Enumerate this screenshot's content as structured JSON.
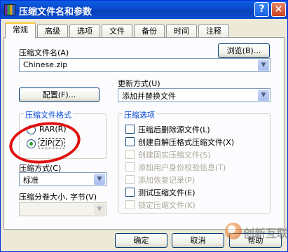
{
  "window": {
    "title": "压缩文件名和参数"
  },
  "titlebar": {
    "help_label": "?",
    "close_label": "×"
  },
  "tabs": [
    "常规",
    "高级",
    "选项",
    "文件",
    "备份",
    "时间",
    "注释"
  ],
  "general": {
    "archive_name_label": "压缩文件名(A)",
    "browse_label": "浏览(B)...",
    "archive_name_value": "Chinese.zip",
    "update_mode_label": "更新方式(U)",
    "profiles_label": "配置(F)...",
    "update_mode_value": "添加并替换文件",
    "format_group_title": "压缩文件格式",
    "format_rar_label": "RAR(R)",
    "format_zip_label": "ZIP(Z)",
    "method_label": "压缩方式(C)",
    "method_value": "标准",
    "split_label": "压缩分卷大小, 字节(V)",
    "split_value": "",
    "options_group_title": "压缩选项",
    "options": [
      {
        "label": "压缩后删除源文件(L)",
        "enabled": true,
        "checked": false
      },
      {
        "label": "创建自解压格式压缩文件(X)",
        "enabled": true,
        "checked": false
      },
      {
        "label": "创建固实压缩文件(S)",
        "enabled": false,
        "checked": false
      },
      {
        "label": "添加用户身份校验信息(T)",
        "enabled": false,
        "checked": false
      },
      {
        "label": "添加恢复记录(P)",
        "enabled": false,
        "checked": false
      },
      {
        "label": "测试压缩文件(E)",
        "enabled": true,
        "checked": false
      },
      {
        "label": "锁定压缩文件(K)",
        "enabled": false,
        "checked": false
      }
    ]
  },
  "footer": {
    "ok_label": "确定",
    "cancel_label": "取消",
    "help_label": "帮助"
  },
  "watermark": {
    "text": "创新互联"
  },
  "colors": {
    "titlebar": "#0a47c9",
    "annotation": "#e01010",
    "group_title": "#0046d5"
  }
}
